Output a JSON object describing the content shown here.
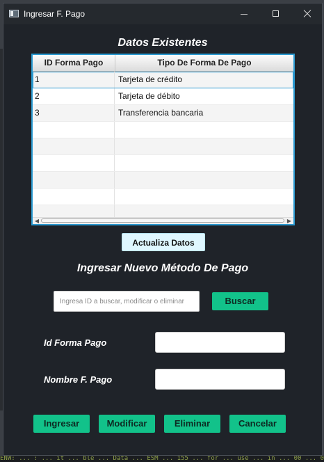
{
  "window": {
    "title": "Ingresar F. Pago"
  },
  "existing_section": {
    "title": "Datos Existentes"
  },
  "table": {
    "columns": [
      "ID Forma Pago",
      "Tipo De Forma De Pago"
    ],
    "rows": [
      {
        "id": "1",
        "tipo": "Tarjeta de crédito"
      },
      {
        "id": "2",
        "tipo": "Tarjeta de débito"
      },
      {
        "id": "3",
        "tipo": "Transferencia bancaria"
      },
      {
        "id": "",
        "tipo": ""
      },
      {
        "id": "",
        "tipo": ""
      },
      {
        "id": "",
        "tipo": ""
      },
      {
        "id": "",
        "tipo": ""
      },
      {
        "id": "",
        "tipo": ""
      },
      {
        "id": "",
        "tipo": ""
      }
    ]
  },
  "refresh_button": {
    "label": "Actualiza Datos"
  },
  "new_section": {
    "title": "Ingresar Nuevo Método De Pago"
  },
  "search": {
    "placeholder": "Ingresa ID a buscar, modificar o eliminar",
    "value": "",
    "button_label": "Buscar"
  },
  "form": {
    "id_label": "Id Forma Pago",
    "id_value": "",
    "name_label": "Nombre F. Pago",
    "name_value": ""
  },
  "actions": {
    "ingresar": "Ingresar",
    "modificar": "Modificar",
    "eliminar": "Eliminar",
    "cancelar": "Cancelar"
  },
  "background": {
    "console_text": "ENW: ... : ... it ... ble ... Data ... ESM ... 155 ... for ... use ... in ... 00 ... 0"
  },
  "colors": {
    "window_bg": "#1f2329",
    "accent_green": "#12c28a",
    "selection_border": "#2b9ad1",
    "refresh_button_bg": "#dff7ff"
  }
}
